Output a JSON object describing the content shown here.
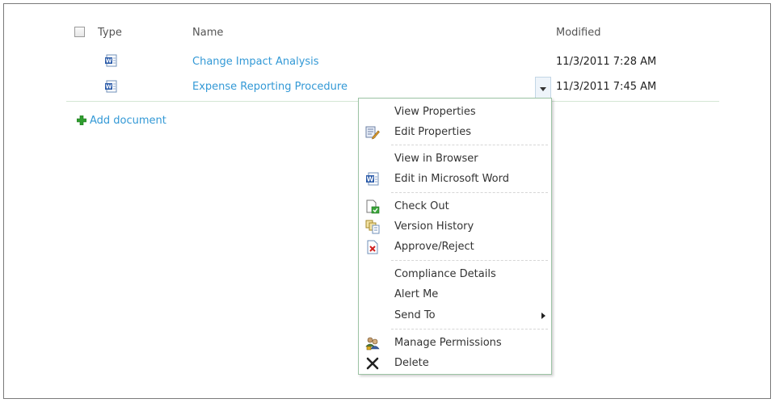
{
  "list": {
    "columns": {
      "type": "Type",
      "name": "Name",
      "modified": "Modified"
    },
    "rows": [
      {
        "name": "Change Impact Analysis",
        "modified": "11/3/2011 7:28 AM",
        "icon": "word-doc-icon"
      },
      {
        "name": "Expense Reporting Procedure",
        "modified": "11/3/2011 7:45 AM",
        "icon": "word-doc-icon"
      }
    ],
    "add_document": "Add document"
  },
  "context_menu": {
    "items": [
      {
        "label": "View Properties",
        "icon": ""
      },
      {
        "label": "Edit Properties",
        "icon": "edit-properties-icon"
      },
      {
        "label": "View in Browser",
        "icon": ""
      },
      {
        "label": "Edit in Microsoft Word",
        "icon": "word-doc-icon"
      },
      {
        "label": "Check Out",
        "icon": "check-out-icon"
      },
      {
        "label": "Version History",
        "icon": "version-history-icon"
      },
      {
        "label": "Approve/Reject",
        "icon": "approve-reject-icon"
      },
      {
        "label": "Compliance Details",
        "icon": ""
      },
      {
        "label": "Alert Me",
        "icon": ""
      },
      {
        "label": "Send To",
        "icon": ""
      },
      {
        "label": "Manage Permissions",
        "icon": "manage-permissions-icon"
      },
      {
        "label": "Delete",
        "icon": "delete-icon"
      }
    ]
  },
  "colors": {
    "link": "#3399d6",
    "menu_border": "#9cc3a4",
    "add_green": "#2f9e2f"
  }
}
